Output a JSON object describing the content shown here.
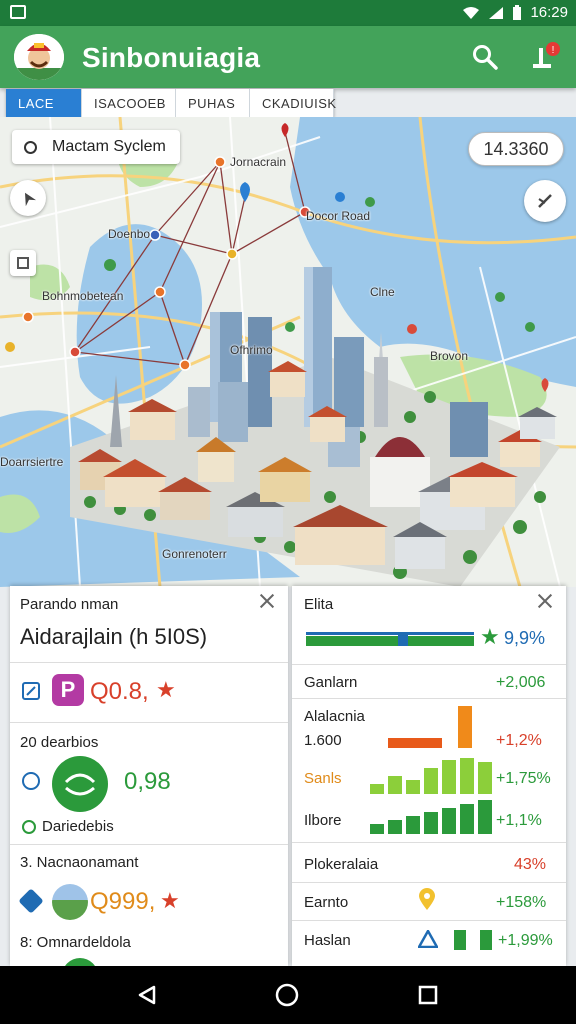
{
  "status_bar": {
    "time": "16:29"
  },
  "app": {
    "title": "Sinbonuiagia"
  },
  "filters": [
    {
      "label": "LACE",
      "active": true
    },
    {
      "label": "ISACOOEB",
      "active": false
    },
    {
      "label": "PUHAS",
      "active": false
    },
    {
      "label": "CKADIUISK",
      "active": false
    }
  ],
  "map": {
    "search_label": "Mactam Syclem",
    "coords": "14.3360",
    "labels": [
      "Jornacrain",
      "Doenbo",
      "Docor Road",
      "Bohnmobetean",
      "Ofhrimo",
      "Clne",
      "Doarrsiertre",
      "Gonrenoterr",
      "Brovon"
    ]
  },
  "left_panel": {
    "subtitle": "Parando nman",
    "title": "Aidarajlain (h 5I0S)",
    "row1": {
      "badge": "P",
      "value": "Q0.8,"
    },
    "section2": {
      "label": "20 dearbios",
      "value": "0,98",
      "caption": "Dariedebis"
    },
    "section3": {
      "label": "3. Nacnaonamant",
      "value": "Q999,",
      "caption": "8: Omnardeldola"
    }
  },
  "right_panel": {
    "title": "Elita",
    "bar_value": "9,9%",
    "rows": [
      {
        "label": "Ganlarn",
        "value": "+2,006",
        "color": "green"
      },
      {
        "label": "Alalacnia",
        "sublabel": "1.600",
        "value": "+1,2%",
        "color": "red"
      },
      {
        "label": "Sanls",
        "value": "+1,75%",
        "color": "green"
      },
      {
        "label": "Ilbore",
        "value": "+1,1%",
        "color": "green"
      },
      {
        "label": "Plokeralaia",
        "value": "43%",
        "color": "red"
      },
      {
        "label": "Earnto",
        "value": "+158%",
        "color": "green"
      },
      {
        "label": "Haslan",
        "value": "+1,99%",
        "color": "green"
      }
    ]
  },
  "colors": {
    "app_bar": "#43a35a",
    "status_bar": "#1e7b3a",
    "accent_blue": "#2a7fd3",
    "positive": "#2b9a3b",
    "negative": "#d8402a"
  },
  "icons": {
    "search": "search-icon",
    "notification": "alert-icon",
    "compass": "compass-icon",
    "location": "locate-icon"
  }
}
